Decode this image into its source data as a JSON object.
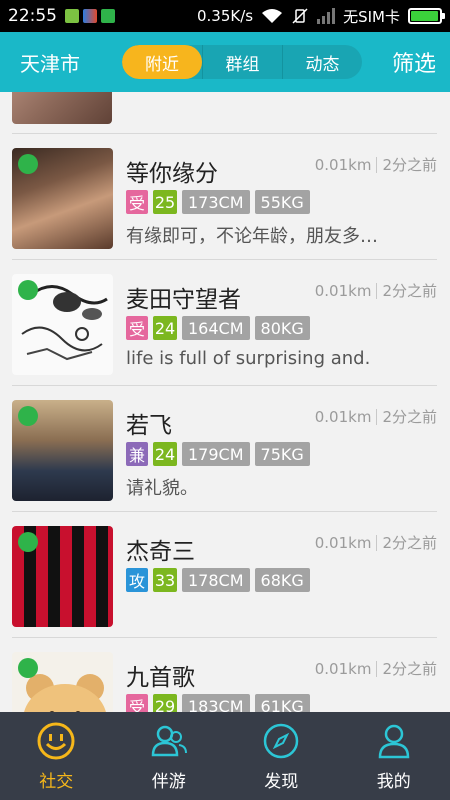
{
  "status_bar": {
    "time": "22:55",
    "speed": "0.35K/s",
    "sim": "无SIM卡",
    "battery_level": 0.95
  },
  "header": {
    "city": "天津市",
    "tabs": [
      {
        "label": "附近",
        "active": true
      },
      {
        "label": "群组",
        "active": false
      },
      {
        "label": "动态",
        "active": false
      }
    ],
    "filter": "筛选"
  },
  "colors": {
    "accent": "#1ab8c8",
    "tab_active": "#f7b51d",
    "online": "#2fb34a",
    "age_tag": "#7cb71f",
    "stat_tag": "#a3a3a3",
    "role_受": "#e5679d",
    "role_兼": "#8c6ab8",
    "role_攻": "#2a94d8"
  },
  "users": [
    {
      "name": "等你缘分",
      "distance": "0.01km",
      "time": "2分之前",
      "role": "受",
      "age": "25",
      "height": "173CM",
      "weight": "55KG",
      "bio": "有缘即可，不论年龄，朋友多…",
      "online": true
    },
    {
      "name": "麦田守望者",
      "distance": "0.01km",
      "time": "2分之前",
      "role": "受",
      "age": "24",
      "height": "164CM",
      "weight": "80KG",
      "bio": " life is full of surprising  and.",
      "online": true
    },
    {
      "name": "若飞",
      "distance": "0.01km",
      "time": "2分之前",
      "role": "兼",
      "age": "24",
      "height": "179CM",
      "weight": "75KG",
      "bio": "请礼貌。",
      "online": true
    },
    {
      "name": "杰奇三",
      "distance": "0.01km",
      "time": "2分之前",
      "role": "攻",
      "age": "33",
      "height": "178CM",
      "weight": "68KG",
      "bio": "",
      "online": true
    },
    {
      "name": "九首歌",
      "distance": "0.01km",
      "time": "2分之前",
      "role": "受",
      "age": "29",
      "height": "183CM",
      "weight": "61KG",
      "bio": "",
      "online": true
    }
  ],
  "bottom_nav": [
    {
      "label": "社交",
      "icon": "smiley-icon",
      "active": true
    },
    {
      "label": "伴游",
      "icon": "people-icon",
      "active": false
    },
    {
      "label": "发现",
      "icon": "compass-icon",
      "active": false
    },
    {
      "label": "我的",
      "icon": "person-icon",
      "active": false
    }
  ]
}
